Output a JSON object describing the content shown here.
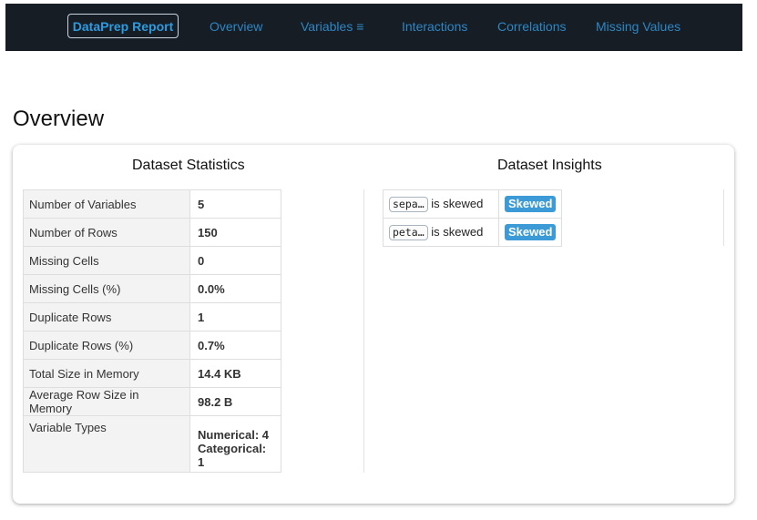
{
  "navbar": {
    "brand": "DataPrep Report",
    "links": [
      "Overview",
      "Variables ≡",
      "Interactions",
      "Correlations",
      "Missing Values"
    ]
  },
  "page": {
    "title": "Overview"
  },
  "stats": {
    "title": "Dataset Statistics",
    "rows": [
      {
        "label": "Number of Variables",
        "value": "5"
      },
      {
        "label": "Number of Rows",
        "value": "150"
      },
      {
        "label": "Missing Cells",
        "value": "0"
      },
      {
        "label": "Missing Cells (%)",
        "value": "0.0%"
      },
      {
        "label": "Duplicate Rows",
        "value": "1"
      },
      {
        "label": "Duplicate Rows (%)",
        "value": "0.7%"
      },
      {
        "label": "Total Size in Memory",
        "value": "14.4 KB"
      },
      {
        "label": "Average Row Size in Memory",
        "value": "98.2 B"
      },
      {
        "label": "Variable Types",
        "value_lines": [
          "Numerical: 4",
          "Categorical: 1"
        ]
      }
    ]
  },
  "insights": {
    "title": "Dataset Insights",
    "items": [
      {
        "column": "sepa…",
        "text": "is skewed",
        "badge": "Skewed"
      },
      {
        "column": "peta…",
        "text": "is skewed",
        "badge": "Skewed"
      }
    ]
  },
  "colors": {
    "navbar_bg": "#171d24",
    "link": "#2d86c4",
    "brand": "#2d9be0",
    "badge": "#3c9bd6"
  }
}
